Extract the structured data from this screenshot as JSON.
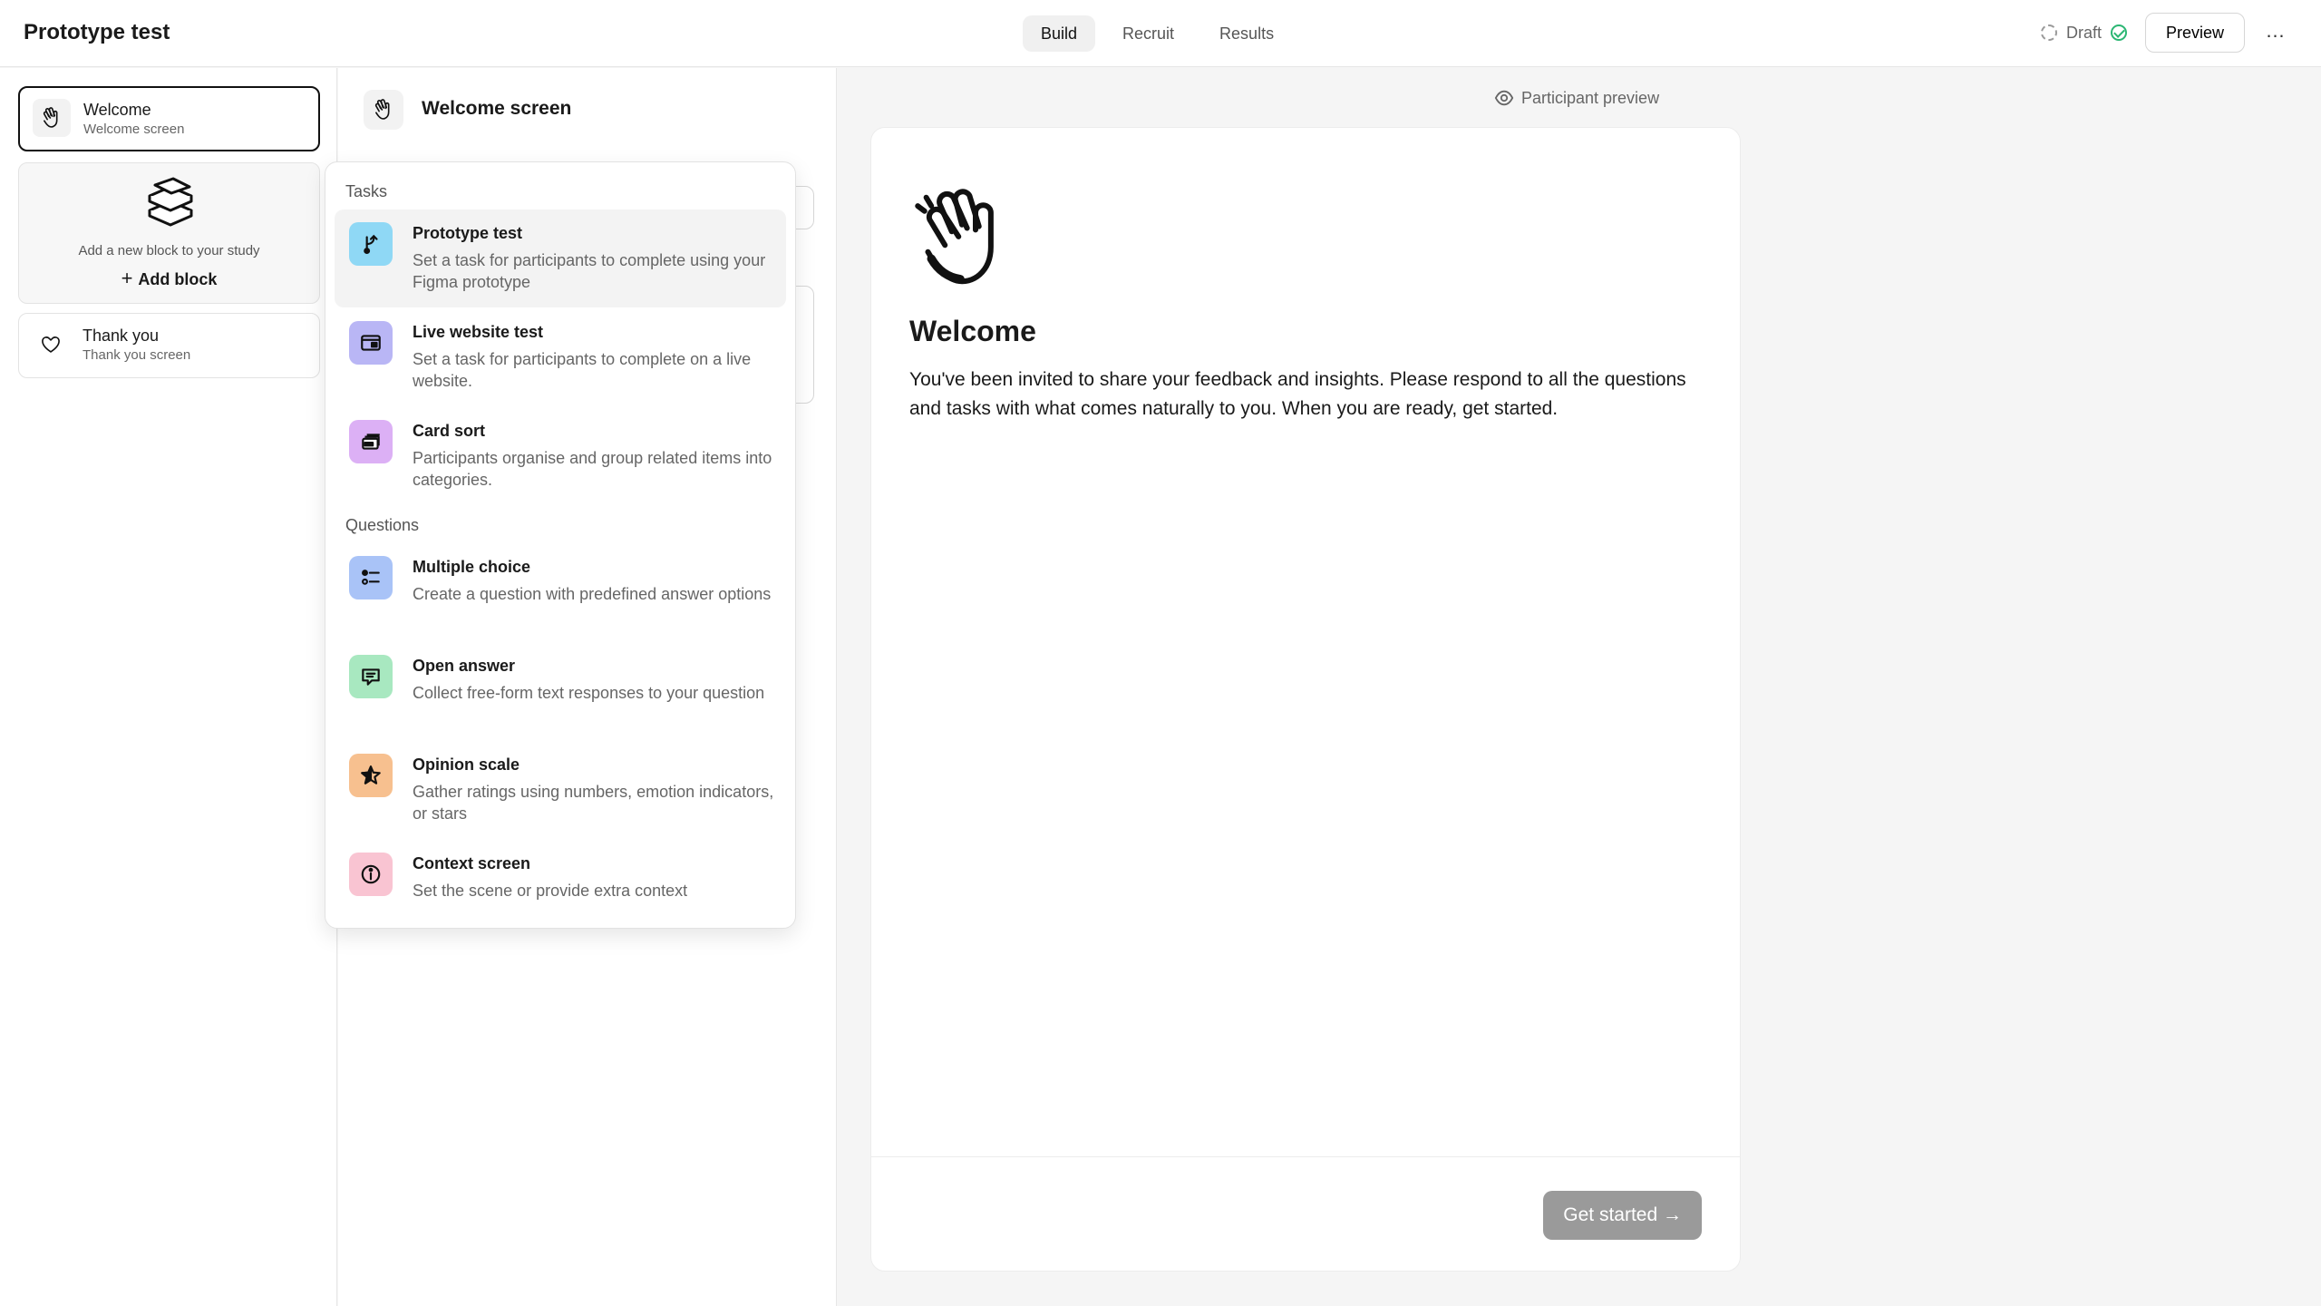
{
  "app": {
    "title": "Prototype test"
  },
  "header": {
    "tabs": [
      {
        "label": "Build",
        "active": true
      },
      {
        "label": "Recruit",
        "active": false
      },
      {
        "label": "Results",
        "active": false
      }
    ],
    "status_label": "Draft",
    "preview_label": "Preview",
    "more_label": "…"
  },
  "sidebar": {
    "blocks": [
      {
        "title": "Welcome",
        "subtitle": "Welcome screen",
        "icon": "hand-wave-icon",
        "selected": true
      },
      {
        "title": "Thank you",
        "subtitle": "Thank you screen",
        "icon": "heart-hand-icon",
        "selected": false
      }
    ],
    "add_block": {
      "text": "Add a new block to your study",
      "button": "Add block"
    }
  },
  "editor": {
    "title": "Welcome screen"
  },
  "menu": {
    "sections": [
      {
        "label": "Tasks",
        "items": [
          {
            "title": "Prototype test",
            "desc": "Set a task for participants to complete using your Figma prototype",
            "icon": "prototype-icon",
            "color": "#8fd8f5"
          },
          {
            "title": "Live website test",
            "desc": "Set a task for participants to complete on a live website.",
            "icon": "browser-icon",
            "color": "#b9b6f5"
          },
          {
            "title": "Card sort",
            "desc": "Participants organise and group related items into categories.",
            "icon": "cards-icon",
            "color": "#dcb0f5"
          }
        ]
      },
      {
        "label": "Questions",
        "items": [
          {
            "title": "Multiple choice",
            "desc": "Create a question with predefined answer options",
            "icon": "list-icon",
            "color": "#a9c3f7"
          },
          {
            "title": "Open answer",
            "desc": "Collect free-form text responses to your question",
            "icon": "chat-icon",
            "color": "#a8e8c0"
          },
          {
            "title": "Opinion scale",
            "desc": "Gather ratings using numbers, emotion indicators, or stars",
            "icon": "star-icon",
            "color": "#f7c08f"
          },
          {
            "title": "Context screen",
            "desc": "Set the scene or provide extra context",
            "icon": "info-icon",
            "color": "#f9c4d2"
          }
        ]
      }
    ]
  },
  "preview": {
    "label": "Participant preview",
    "heading": "Welcome",
    "body": "You've been invited to share your feedback and insights. Please respond to all the questions and tasks with what comes naturally to you. When you are ready, get started.",
    "button": "Get started →"
  }
}
